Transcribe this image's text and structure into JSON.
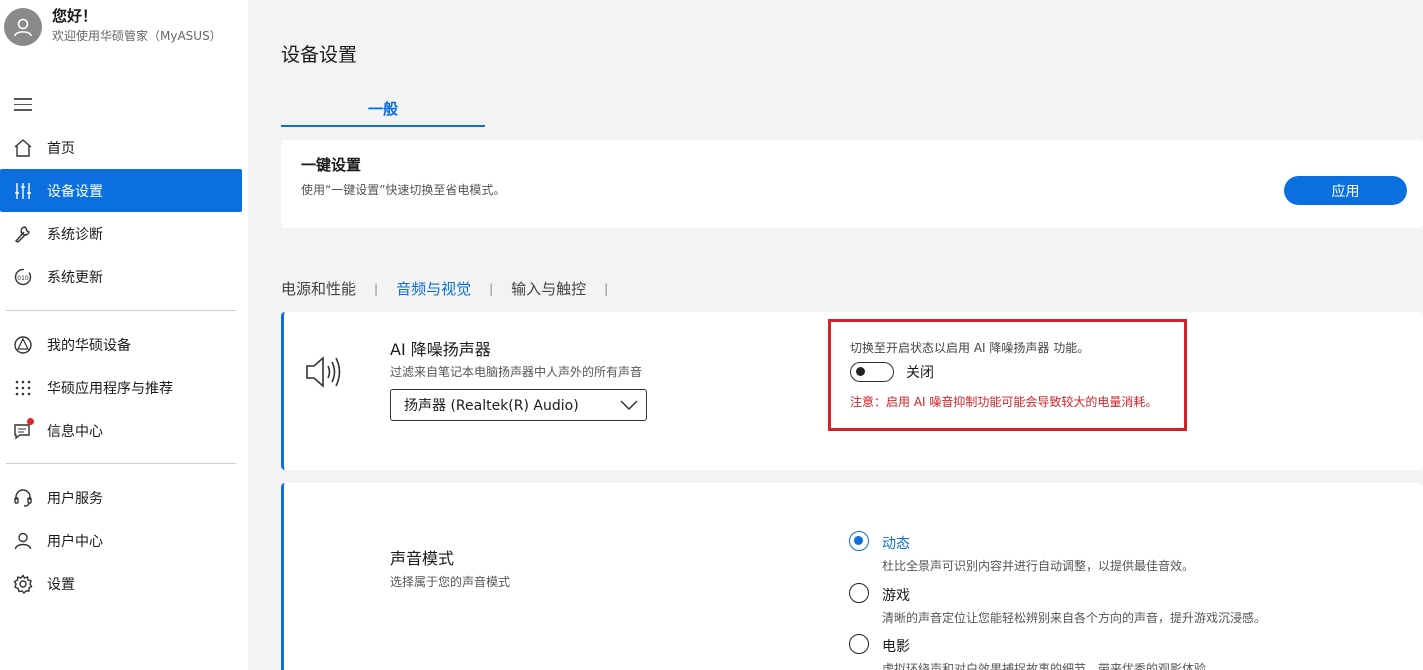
{
  "profile": {
    "greeting": "您好！",
    "welcome": "欢迎使用华硕管家（MyASUS）"
  },
  "nav": {
    "home": "首页",
    "device_settings": "设备设置",
    "diagnostics": "系统诊断",
    "update": "系统更新",
    "my_devices": "我的华硕设备",
    "apps": "华硕应用程序与推荐",
    "messages": "信息中心",
    "customer_service": "用户服务",
    "user_center": "用户中心",
    "settings": "设置"
  },
  "page": {
    "title": "设备设置",
    "tab_general": "一般"
  },
  "onekey": {
    "title": "一键设置",
    "desc": "使用“一键设置”快速切换至省电模式。",
    "apply": "应用"
  },
  "subtabs": [
    "电源和性能",
    "音频与视觉",
    "输入与触控"
  ],
  "speaker": {
    "title": "AI 降噪扬声器",
    "desc": "过滤来自笔记本电脑扬声器中人声外的所有声音",
    "device": "扬声器 (Realtek(R) Audio)",
    "hint": "切换至开启状态以启用 AI 降噪扬声器 功能。",
    "toggle_state": "关闭",
    "warning": "注意：启用 AI 噪音抑制功能可能会导致较大的电量消耗。"
  },
  "sound_mode": {
    "title": "声音模式",
    "desc": "选择属于您的声音模式",
    "options": [
      {
        "label": "动态",
        "desc": "杜比全景声可识别内容并进行自动调整，以提供最佳音效。"
      },
      {
        "label": "游戏",
        "desc": "清晰的声音定位让您能轻松辨别来自各个方向的声音，提升游戏沉浸感。"
      },
      {
        "label": "电影",
        "desc": "虚拟环绕声和对白效果捕捉故事的细节，带来优秀的观影体验。"
      }
    ]
  },
  "colors": {
    "accent": "#0b6fe0",
    "warning": "#d62027"
  }
}
